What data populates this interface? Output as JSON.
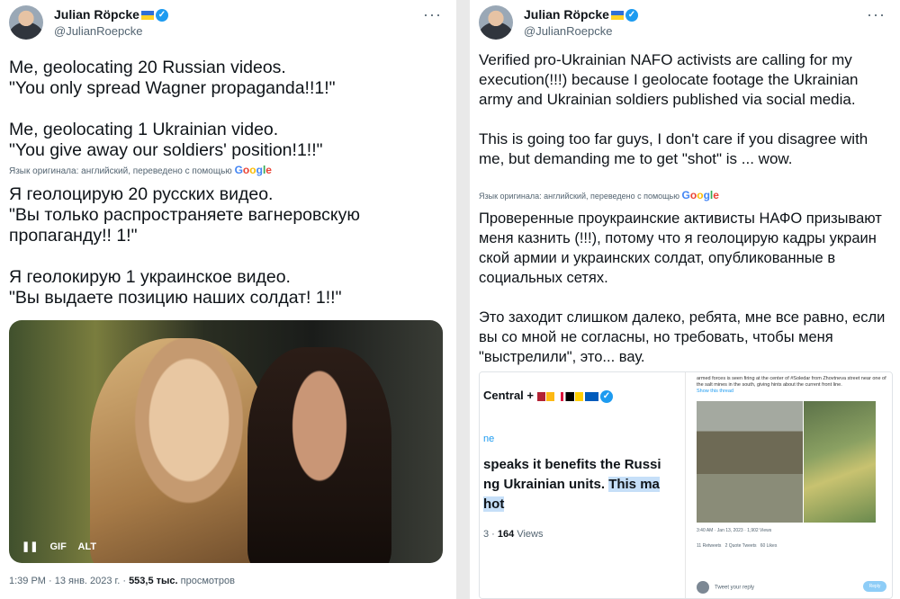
{
  "left": {
    "author_name": "Julian Röpcke",
    "handle": "@JulianRoepcke",
    "more": "···",
    "text_en": "Me, geolocating 20 Russian videos.\n\"You only spread Wagner propaganda!!1!\"\n\nMe, geolocating 1 Ukrainian video.\n\"You give away our soldiers' position!1!!\"",
    "translated_note": "Язык оригинала: английский, переведено с помощью",
    "google": "Google",
    "text_ru": "Я геолоцирую 20 русских видео.\n\"Вы только распространяете вагнеровскую пропаганду!! 1!\"\n\nЯ геолокирую 1 украинское видео.\n\"Вы выдаете позицию наших солдат! 1!!\"",
    "gif_labels": [
      "❚❚",
      "GIF",
      "ALT"
    ],
    "meta_time": "1:39 PM · 13 янв. 2023 г. · ",
    "meta_views": "553,5 тыс.",
    "meta_views_label": " просмотров"
  },
  "right": {
    "author_name": "Julian Röpcke",
    "handle": "@JulianRoepcke",
    "more": "···",
    "text_en": "Verified pro-Ukrainian NAFO activists are calling for my execution(!!!) because I geolocate footage the Ukrainian army and Ukrainian soldiers published via social media.\n\nThis is going too far guys, I don't care if you disagree with me, but demanding me to get \"shot\" is ... wow.",
    "translated_note": "Язык оригинала: английский, переведено с помощью",
    "google": "Google",
    "text_ru": "Проверенные проукраинские активисты НАФО призывают меня казнить (!!!), потому что я геолоцирую кадры украин ской армии и украинских солдат, опубликованные в  социальных сетях.\n\nЭто заходит слишком далеко, ребята, мне все равно, если вы со мной не согласны, но требовать, чтобы меня \"выстрелили\", это... вау.",
    "shot": {
      "crop_head": "Central +",
      "crop_link": "ne",
      "crop_line1": "speaks it benefits the Russi",
      "crop_line2a": "ng Ukrainian units. ",
      "crop_line2b": "This ma",
      "crop_line3": "hot",
      "crop_views_num": "3 · ",
      "crop_views": "164",
      "crop_views_label": " Views",
      "r_text": "armed forces is seen firing at the center of #Soledar from Zhovtneva street near one of the salt mines in the south, giving hints about the current front line.",
      "r_link": "Show this thread",
      "r_meta": "3:40 AM · Jan 13, 2023 · 1,902 Views",
      "r_stats": [
        "11 Retweets",
        "2 Quote Tweets",
        "60 Likes"
      ],
      "reply_placeholder": "Tweet your reply",
      "reply_button": "Reply"
    }
  }
}
